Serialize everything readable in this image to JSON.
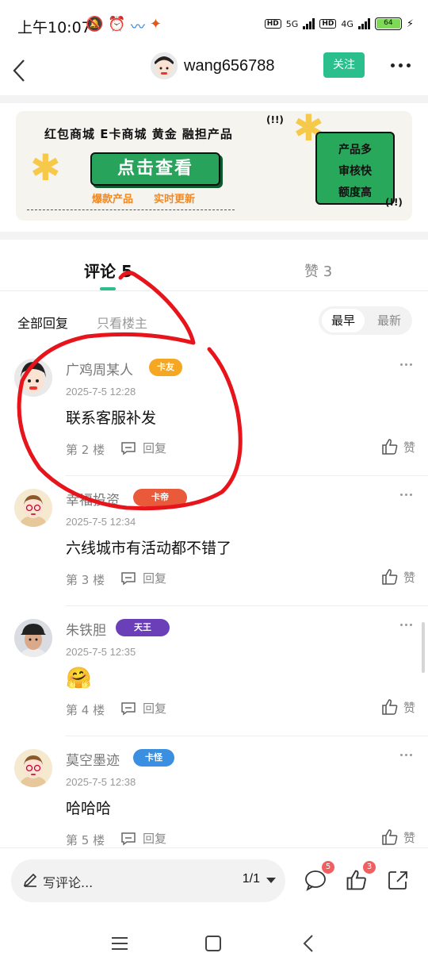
{
  "status_bar": {
    "time": "上午10:07",
    "net1": "5G",
    "net2": "4G",
    "battery": "64"
  },
  "nav": {
    "author_name": "wang656788",
    "follow_label": "关注"
  },
  "banner": {
    "headline": "红包商城  E卡商城  黄金  融担产品",
    "cta": "点击查看",
    "tag1": "爆款产品",
    "tag2": "实时更新",
    "box_lines": [
      "产品多",
      "审核快",
      "额度高"
    ],
    "exclaim": "(!!)"
  },
  "tabs": {
    "comments_label": "评论",
    "comments_count": "5",
    "likes_label": "赞",
    "likes_count": "3"
  },
  "filters": {
    "all_replies": "全部回复",
    "only_op": "只看楼主",
    "sort_early": "最早",
    "sort_latest": "最新"
  },
  "comments": [
    {
      "user": "广鸡周某人",
      "badge": "卡友",
      "badge_color": "#f5a623",
      "time": "2025-7-5 12:28",
      "text": "联系客服补发",
      "floor": "第 2 楼",
      "reply": "回复",
      "like": "赞"
    },
    {
      "user": "幸福投资",
      "badge": "卡帝",
      "badge_color": "#e85a3a",
      "time": "2025-7-5 12:34",
      "text": "六线城市有活动都不错了",
      "floor": "第 3 楼",
      "reply": "回复",
      "like": "赞"
    },
    {
      "user": "朱铁胆",
      "badge": "天王",
      "badge_color": "#6b3fb8",
      "time": "2025-7-5 12:35",
      "text": "",
      "emoji": "🤗",
      "floor": "第 4 楼",
      "reply": "回复",
      "like": "赞"
    },
    {
      "user": "莫空墨迹",
      "badge": "卡怪",
      "badge_color": "#3b8fe0",
      "time": "2025-7-5 12:38",
      "text": "哈哈哈",
      "floor": "第 5 楼",
      "reply": "回复",
      "like": "赞"
    }
  ],
  "bottom_bar": {
    "comment_placeholder": "写评论...",
    "page_indicator": "1/1",
    "comment_count": "5",
    "like_count": "3"
  },
  "colors": {
    "accent": "#2bbf8e",
    "annotation": "#e8141c"
  }
}
